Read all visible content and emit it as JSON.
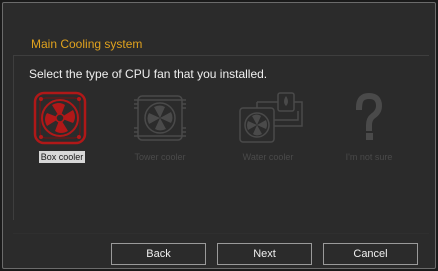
{
  "dialog": {
    "section_title": "Main Cooling system",
    "prompt": "Select the type of CPU fan that you installed."
  },
  "options": [
    {
      "label": "Box cooler",
      "icon": "box-cooler-icon",
      "selected": true
    },
    {
      "label": "Tower cooler",
      "icon": "tower-cooler-icon",
      "selected": false
    },
    {
      "label": "Water cooler",
      "icon": "water-cooler-icon",
      "selected": false
    },
    {
      "label": "I'm not sure",
      "icon": "question-mark-icon",
      "selected": false
    }
  ],
  "buttons": {
    "back": "Back",
    "next": "Next",
    "cancel": "Cancel"
  },
  "colors": {
    "accent": "#e0a21e",
    "selected_icon": "#b01818",
    "dim_icon": "#4a4a4a"
  }
}
